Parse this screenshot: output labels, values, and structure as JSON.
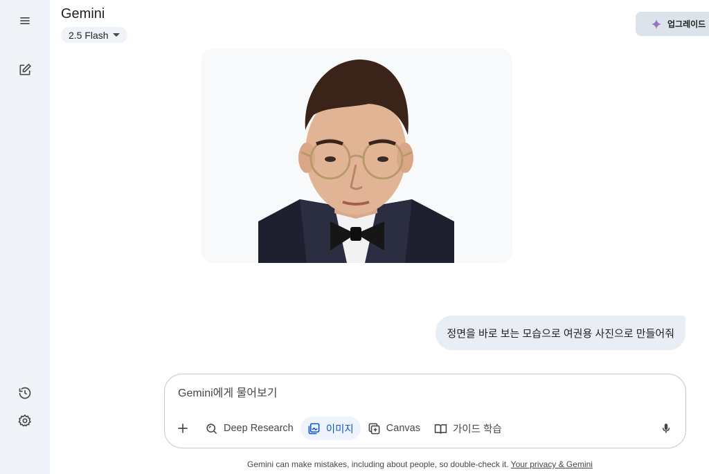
{
  "app": {
    "title": "Gemini"
  },
  "model": {
    "name": "2.5 Flash"
  },
  "header": {
    "upgrade_label": "업그레이드"
  },
  "sidebar": {
    "icons": [
      "menu-icon",
      "new-chat-icon",
      "history-icon",
      "settings-icon"
    ]
  },
  "conversation": {
    "user_message": "정면을 바로 보는 모습으로 여권용 사진으로 만들어줘"
  },
  "composer": {
    "placeholder": "Gemini에게 물어보기",
    "tools": {
      "deep_research": "Deep Research",
      "image": "이미지",
      "canvas": "Canvas",
      "guided_learning": "가이드 학습"
    }
  },
  "footer": {
    "disclaimer": "Gemini can make mistakes, including about people, so double-check it.",
    "privacy_link": "Your privacy & Gemini"
  },
  "colors": {
    "sidebar_bg": "#f0f4f9",
    "accent_blue": "#0b57d0",
    "active_tool_bg": "#eef3fd",
    "user_bubble_bg": "#e9eef6"
  }
}
